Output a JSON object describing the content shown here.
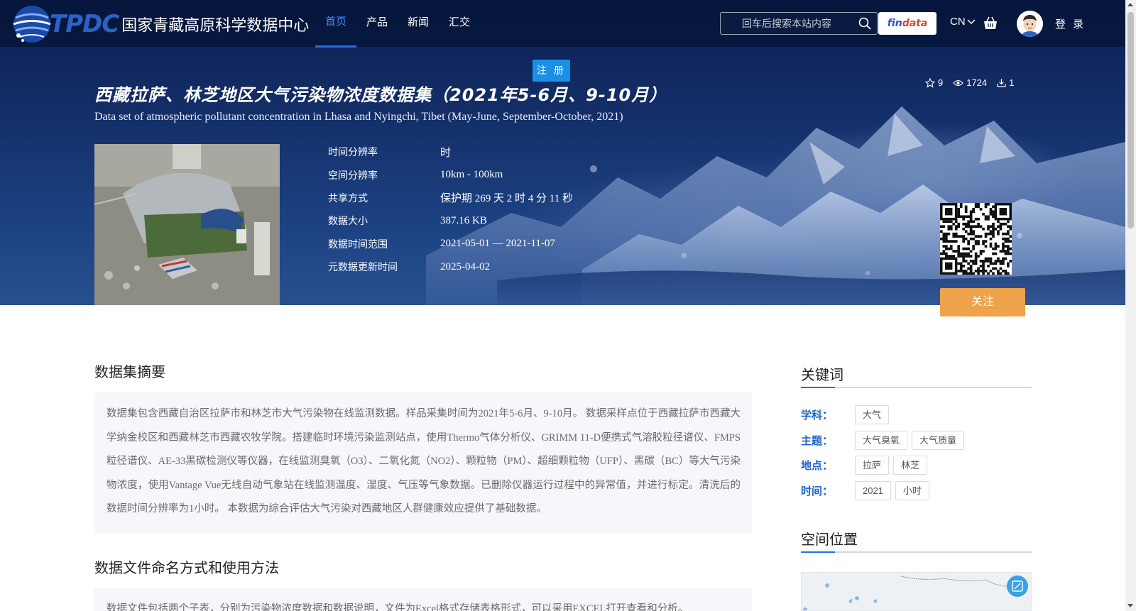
{
  "nav": {
    "logo_en": "TPDC",
    "logo_cn": "国家青藏高原科学数据中心",
    "menu": [
      {
        "label": "首页",
        "active": true
      },
      {
        "label": "产品",
        "active": false
      },
      {
        "label": "新闻",
        "active": false
      },
      {
        "label": "汇交",
        "active": false
      }
    ],
    "search_placeholder": "回车后搜索本站内容",
    "findata_a": "fin",
    "findata_b": "data",
    "lang": "CN",
    "login": "登 录",
    "register": "注 册"
  },
  "dataset": {
    "title_cn": "西藏拉萨、林芝地区大气污染物浓度数据集（2021年5-6月、9-10月）",
    "title_en": "Data set of atmospheric pollutant concentration in Lhasa and Nyingchi, Tibet (May-June, September-October, 2021)",
    "stats": {
      "stars": "9",
      "views": "1724",
      "downloads": "1"
    },
    "meta": [
      {
        "key": "时间分辨率",
        "value": "时"
      },
      {
        "key": "空间分辨率",
        "value": "10km - 100km"
      },
      {
        "key": "共享方式",
        "value": "保护期 269 天 2 时 4 分 11 秒"
      },
      {
        "key": "数据大小",
        "value": "387.16 KB"
      },
      {
        "key": "数据时间范围",
        "value": "2021-05-01 — 2021-11-07"
      },
      {
        "key": "元数据更新时间",
        "value": "2025-04-02"
      }
    ],
    "follow": "关注"
  },
  "abstract": {
    "title": "数据集摘要",
    "text": "数据集包含西藏自治区拉萨市和林芝市大气污染物在线监测数据。样品采集时间为2021年5-6月、9-10月。 数据采样点位于西藏拉萨市西藏大学纳金校区和西藏林芝市西藏农牧学院。搭建临时环境污染监测站点，使用Thermo气体分析仪、GRIMM 11-D便携式气溶胶粒径谱仪、FMPS粒径谱仪、AE-33黑碳检测仪等仪器，在线监测臭氧（O3）、二氧化氮（NO2）、颗粒物（PM）、超细颗粒物（UFP）、黑碳（BC）等大气污染物浓度，使用Vantage Vue无线自动气象站在线监测温度、湿度、气压等气象数据。已删除仪器运行过程中的异常值，并进行标定。清洗后的数据时间分辨率为1小时。 本数据为综合评估大气污染对西藏地区人群健康效应提供了基础数据。"
  },
  "usage": {
    "title": "数据文件命名方式和使用方法",
    "text": "数据文件包括两个子表，分别为污染物浓度数据和数据说明，文件为Excel格式存储表格形式，可以采用EXCEL打开查看和分析。"
  },
  "keywords": {
    "title": "关键词",
    "rows": [
      {
        "label": "学科：",
        "tags": [
          "大气"
        ]
      },
      {
        "label": "主题：",
        "tags": [
          "大气臭氧",
          "大气质量"
        ]
      },
      {
        "label": "地点：",
        "tags": [
          "拉萨",
          "林芝"
        ]
      },
      {
        "label": "时间：",
        "tags": [
          "2021",
          "小时"
        ]
      }
    ]
  },
  "location": {
    "title": "空间位置"
  },
  "colors": {
    "accent": "#1e72e6",
    "follow": "#eea24a",
    "register": "#1a8fe6",
    "keyword_label": "#1d64cf"
  }
}
